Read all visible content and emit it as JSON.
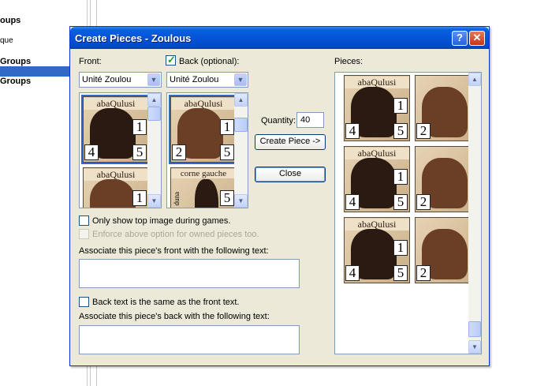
{
  "background": {
    "items": [
      "oups",
      "que",
      "Groups",
      "Groups"
    ]
  },
  "dialog": {
    "title": "Create Pieces - Zoulous",
    "help_label": "?",
    "close_glyph": "✕",
    "front_label": "Front:",
    "back_label": "Back (optional):",
    "back_checked": true,
    "front_combo_value": "Unité Zoulou",
    "back_combo_value": "Unité Zoulou",
    "front_list": [
      {
        "name": "abaQulusi"
      },
      {
        "name": "abaQulusi"
      }
    ],
    "back_list": [
      {
        "name": "abaQulusi"
      },
      {
        "name": "corne gauche"
      }
    ],
    "back_list_side_text": "duna",
    "quantity_label": "Quantity:",
    "quantity_value": "40",
    "create_piece_label": "Create Piece ->",
    "close_label": "Close",
    "only_top_label": "Only show top image during games.",
    "enforce_label": "Enforce above option for owned pieces too.",
    "front_text_label": "Associate this piece's front with the following text:",
    "back_same_label": "Back text is the same as the front text.",
    "back_text_label": "Associate this piece's back with the following text:",
    "pieces_label": "Pieces:",
    "pieces": [
      {
        "name": "abaQulusi",
        "side": "front"
      },
      {
        "name": "",
        "side": "back"
      },
      {
        "name": "abaQulusi",
        "side": "front"
      },
      {
        "name": "",
        "side": "back"
      },
      {
        "name": "abaQulusi",
        "side": "front"
      },
      {
        "name": "",
        "side": "back"
      }
    ],
    "num_one": "1",
    "num_four": "4",
    "num_five": "5",
    "num_two": "2",
    "scroll_up": "▲",
    "scroll_down": "▼",
    "combo_arrow": "▼"
  }
}
